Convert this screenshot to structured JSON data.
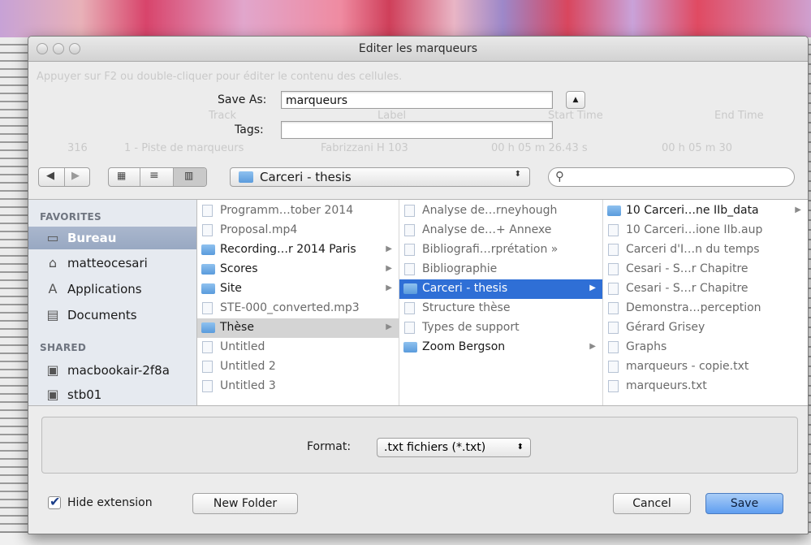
{
  "dialog": {
    "title": "Editer les marqueurs",
    "save_as_label": "Save As:",
    "save_as_value": "marqueurs",
    "tags_label": "Tags:",
    "tags_value": ""
  },
  "background_ghost": {
    "hint": "Appuyer sur F2 ou double-cliquer pour éditer le contenu des cellules.",
    "headers": [
      "Track",
      "Label",
      "Start Time",
      "End Time"
    ],
    "row": [
      "316",
      "1 - Piste de marqueurs",
      "Fabrizzani H 103",
      "00 h 05 m 26.43 s",
      "00 h 05 m 30"
    ]
  },
  "toolbar": {
    "back_icon": "back-arrow-icon",
    "forward_icon": "forward-arrow-icon",
    "view_icons": [
      "icon-view-icon",
      "list-view-icon",
      "column-view-icon"
    ],
    "location": "Carceri - thesis",
    "search_placeholder": ""
  },
  "sidebar": {
    "favorites_header": "FAVORITES",
    "favorites": [
      {
        "label": "Bureau",
        "icon": "desktop-icon",
        "selected": true
      },
      {
        "label": "matteocesari",
        "icon": "home-icon",
        "selected": false
      },
      {
        "label": "Applications",
        "icon": "applications-icon",
        "selected": false
      },
      {
        "label": "Documents",
        "icon": "documents-icon",
        "selected": false
      }
    ],
    "shared_header": "SHARED",
    "shared": [
      {
        "label": "macbookair-2f8a",
        "icon": "computer-icon"
      },
      {
        "label": "stb01",
        "icon": "computer-icon"
      }
    ]
  },
  "columns": [
    {
      "items": [
        {
          "name": "Programm…tober 2014",
          "kind": "file",
          "state": "normal"
        },
        {
          "name": "Proposal.mp4",
          "kind": "file",
          "state": "normal"
        },
        {
          "name": "Recording…r 2014 Paris",
          "kind": "folder",
          "state": "normal"
        },
        {
          "name": "Scores",
          "kind": "folder",
          "state": "normal"
        },
        {
          "name": "Site",
          "kind": "folder",
          "state": "normal"
        },
        {
          "name": "STE-000_converted.mp3",
          "kind": "file",
          "state": "normal"
        },
        {
          "name": "Thèse",
          "kind": "folder",
          "state": "highlighted"
        },
        {
          "name": "Untitled",
          "kind": "file",
          "state": "normal"
        },
        {
          "name": "Untitled 2",
          "kind": "file",
          "state": "normal"
        },
        {
          "name": "Untitled 3",
          "kind": "file",
          "state": "normal"
        }
      ]
    },
    {
      "items": [
        {
          "name": "Analyse de…rneyhough",
          "kind": "file",
          "state": "normal"
        },
        {
          "name": "Analyse de…+ Annexe",
          "kind": "file",
          "state": "normal"
        },
        {
          "name": "Bibliografi…rprétation »",
          "kind": "file",
          "state": "normal"
        },
        {
          "name": "Bibliographie",
          "kind": "file",
          "state": "normal"
        },
        {
          "name": "Carceri - thesis",
          "kind": "folder",
          "state": "selected"
        },
        {
          "name": "Structure thèse",
          "kind": "file",
          "state": "normal"
        },
        {
          "name": "Types de support",
          "kind": "file",
          "state": "normal"
        },
        {
          "name": "Zoom Bergson",
          "kind": "folder",
          "state": "normal"
        }
      ]
    },
    {
      "items": [
        {
          "name": "10 Carceri…ne IIb_data",
          "kind": "folder",
          "state": "normal"
        },
        {
          "name": "10 Carceri…ione IIb.aup",
          "kind": "file",
          "state": "normal"
        },
        {
          "name": "Carceri d'I…n du temps",
          "kind": "file",
          "state": "normal"
        },
        {
          "name": "Cesari - S…r Chapitre",
          "kind": "file",
          "state": "normal"
        },
        {
          "name": "Cesari - S…r Chapitre",
          "kind": "file",
          "state": "normal"
        },
        {
          "name": "Demonstra…perception",
          "kind": "file",
          "state": "normal"
        },
        {
          "name": "Gérard Grisey",
          "kind": "file",
          "state": "normal"
        },
        {
          "name": "Graphs",
          "kind": "file",
          "state": "normal"
        },
        {
          "name": "marqueurs - copie.txt",
          "kind": "file",
          "state": "normal"
        },
        {
          "name": "marqueurs.txt",
          "kind": "file",
          "state": "normal"
        }
      ]
    }
  ],
  "format": {
    "label": "Format:",
    "value": ".txt fichiers (*.txt)"
  },
  "footer": {
    "hide_extension_label": "Hide extension",
    "hide_extension_checked": true,
    "new_folder_label": "New Folder",
    "cancel_label": "Cancel",
    "save_label": "Save"
  },
  "colors": {
    "selection_blue": "#2f6fd6",
    "sidebar_bg": "#e6eaf0",
    "save_button": "#5f9ef0"
  }
}
